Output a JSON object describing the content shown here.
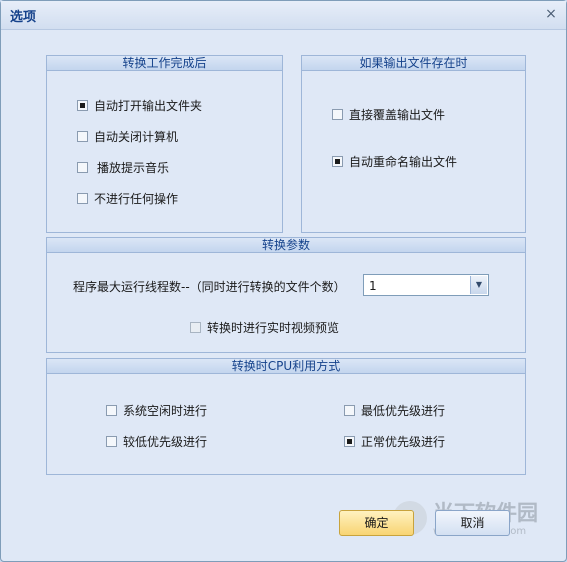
{
  "dialog": {
    "title": "选项",
    "close_glyph": "×"
  },
  "after_conversion": {
    "header": "转换工作完成后",
    "options": [
      {
        "label": "自动打开输出文件夹",
        "checked": true
      },
      {
        "label": "自动关闭计算机",
        "checked": false
      },
      {
        "label": "播放提示音乐",
        "checked": false
      },
      {
        "label": "不进行任何操作",
        "checked": false
      }
    ]
  },
  "output_exists": {
    "header": "如果输出文件存在时",
    "options": [
      {
        "label": "直接覆盖输出文件",
        "checked": false
      },
      {
        "label": "自动重命名输出文件",
        "checked": true
      }
    ]
  },
  "conversion_params": {
    "header": "转换参数",
    "threads_label": "程序最大运行线程数--（同时进行转换的文件个数）",
    "threads_value": "1",
    "preview_label": "转换时进行实时视频预览",
    "preview_checked": false
  },
  "cpu_usage": {
    "header": "转换时CPU利用方式",
    "options": [
      {
        "label": "系统空闲时进行",
        "checked": false
      },
      {
        "label": "最低优先级进行",
        "checked": false
      },
      {
        "label": "较低优先级进行",
        "checked": false
      },
      {
        "label": "正常优先级进行",
        "checked": true
      }
    ]
  },
  "buttons": {
    "ok": "确定",
    "cancel": "取消"
  },
  "watermark": {
    "name": "当下软件园",
    "url": "www.downxia.com"
  }
}
